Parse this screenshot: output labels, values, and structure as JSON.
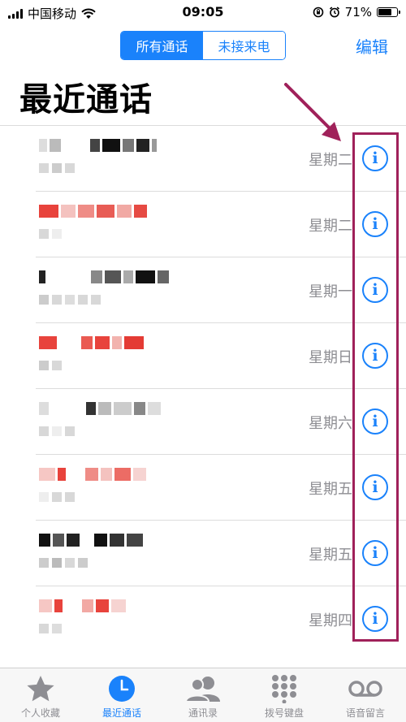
{
  "status_bar": {
    "carrier": "中国移动",
    "time": "09:05",
    "battery": "71%",
    "battery_level": 0.71
  },
  "nav": {
    "segments": [
      "所有通话",
      "未接来电"
    ],
    "selected_segment": "所有通话",
    "edit_label": "编辑"
  },
  "page_title": "最近通话",
  "calls": [
    {
      "day": "星期二"
    },
    {
      "day": "星期二"
    },
    {
      "day": "星期一"
    },
    {
      "day": "星期日"
    },
    {
      "day": "星期六"
    },
    {
      "day": "星期五"
    },
    {
      "day": "星期五"
    },
    {
      "day": "星期四"
    }
  ],
  "info_icon_glyph": "i",
  "tab_bar": {
    "items": [
      {
        "label": "个人收藏",
        "icon": "star-icon"
      },
      {
        "label": "最近通话",
        "icon": "clock-icon"
      },
      {
        "label": "通讯录",
        "icon": "contacts-icon"
      },
      {
        "label": "拨号键盘",
        "icon": "keypad-icon"
      },
      {
        "label": "语音留言",
        "icon": "voicemail-icon"
      }
    ],
    "selected": "最近通话"
  },
  "colors": {
    "accent": "#1a82fb",
    "annotation": "#a0215a",
    "secondary_text": "#8e8e93"
  }
}
